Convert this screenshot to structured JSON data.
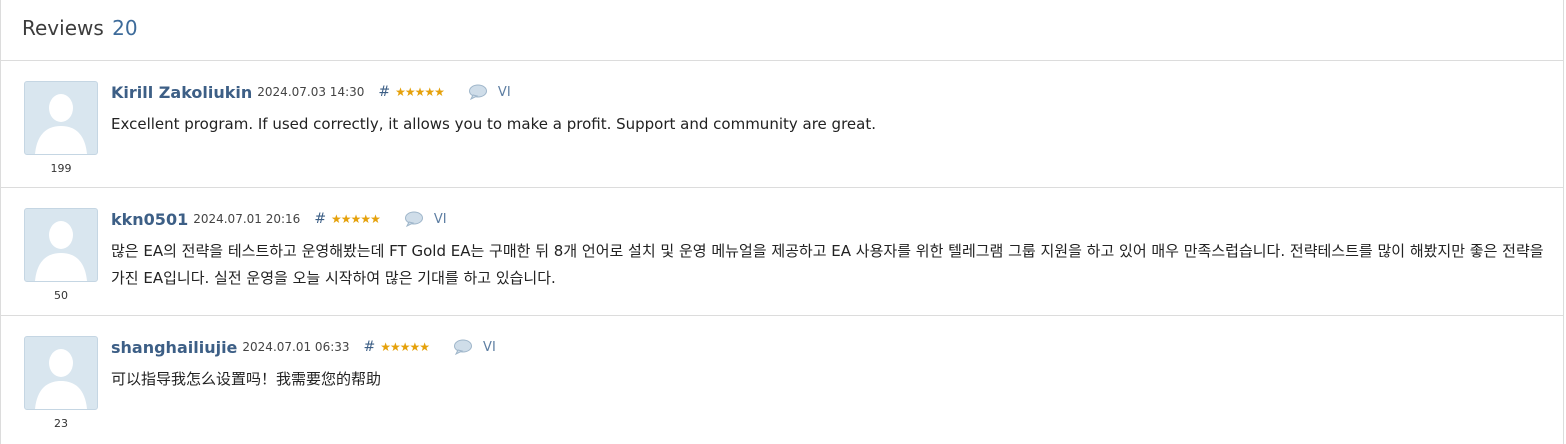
{
  "header": {
    "title": "Reviews",
    "count": "20"
  },
  "reviews": [
    {
      "author": "Kirill Zakoliukin",
      "date": "2024.07.03 14:30",
      "hash": "#",
      "stars": "★★★★★",
      "translate": "VI",
      "rating_count": "199",
      "text": "Excellent program. If used correctly, it allows you to make a profit. Support and community are great."
    },
    {
      "author": "kkn0501",
      "date": "2024.07.01 20:16",
      "hash": "#",
      "stars": "★★★★★",
      "translate": "VI",
      "rating_count": "50",
      "text": "많은 EA의 전략을 테스트하고 운영해봤는데 FT Gold EA는 구매한 뒤 8개 언어로 설치 및 운영 메뉴얼을 제공하고 EA 사용자를 위한 텔레그램 그룹 지원을 하고 있어 매우 만족스럽습니다. 전략테스트를 많이 해봤지만 좋은 전략을 가진 EA입니다. 실전 운영을 오늘 시작하여 많은 기대를 하고 있습니다."
    },
    {
      "author": "shanghailiujie",
      "date": "2024.07.01 06:33",
      "hash": "#",
      "stars": "★★★★★",
      "translate": "VI",
      "rating_count": "23",
      "text": "可以指导我怎么设置吗！我需要您的帮助"
    }
  ],
  "icons": {
    "avatar": "user-silhouette-icon",
    "comment": "speech-bubble-icon",
    "star": "star-icon"
  },
  "colors": {
    "author": "#3d5f86",
    "count": "#3d6b9a",
    "stars": "#e5a10b",
    "avatar_bg": "#d9e6ef",
    "divider": "#dcdcdc"
  }
}
